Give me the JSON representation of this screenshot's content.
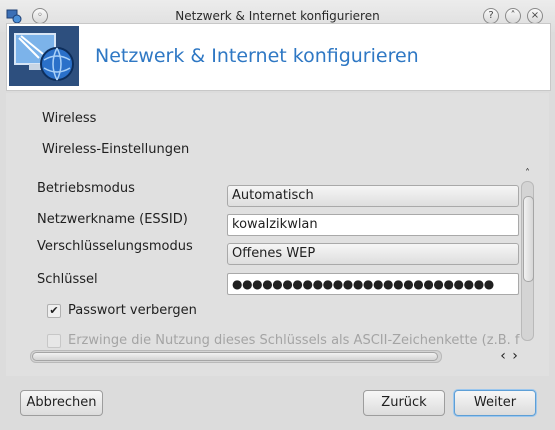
{
  "window": {
    "title": "Netzwerk & Internet konfigurieren"
  },
  "banner": {
    "title": "Netzwerk & Internet konfigurieren"
  },
  "section": {
    "heading": "Wireless",
    "subheading": "Wireless-Einstellungen"
  },
  "form": {
    "mode_label": "Betriebsmodus",
    "mode_value": "Automatisch",
    "essid_label": "Netzwerkname (ESSID)",
    "essid_value": "kowalzikwlan",
    "encryption_label": "Verschlüsselungsmodus",
    "encryption_value": "Offenes WEP",
    "key_label": "Schlüssel",
    "key_value": "●●●●●●●●●●●●●●●●●●●●●●●●●●",
    "hide_password_label": "Passwort verbergen",
    "hide_password_checked": true,
    "force_ascii_label": "Erzwinge die Nutzung dieses Schlüssels als ASCII-Zeichenkette (z.B. fü",
    "force_ascii_checked": false
  },
  "buttons": {
    "cancel": "Abbrechen",
    "back": "Zurück",
    "next": "Weiter"
  },
  "icons": {
    "app": "network-config-icon",
    "banner": "network-monitor-globe-icon"
  },
  "colors": {
    "banner_title": "#2f78c4",
    "default_button_border": "#5e9fd6"
  }
}
